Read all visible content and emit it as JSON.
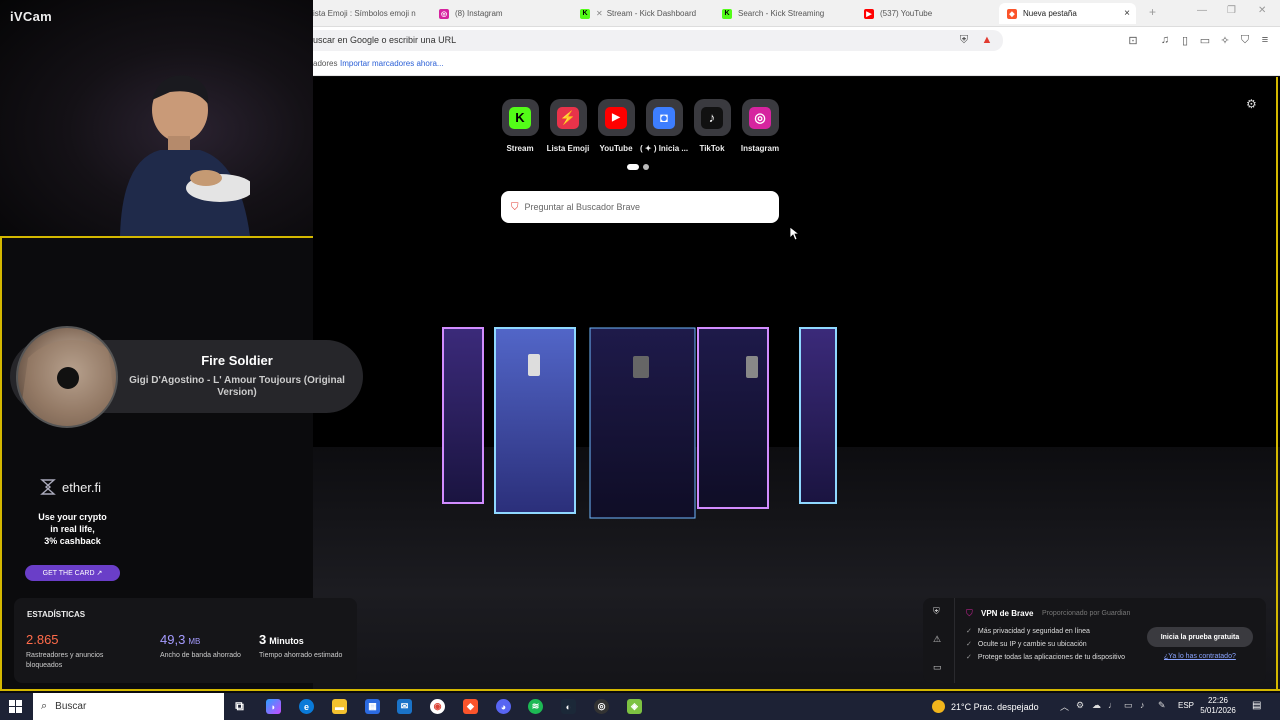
{
  "webcam": {
    "label": "iVCam"
  },
  "browser": {
    "tabs": [
      {
        "title": "ista Emoji : Símbolos emoji n",
        "icon": "",
        "color": "#999999"
      },
      {
        "title": "(8) Instagram",
        "icon": "instagram-icon",
        "color": "#d6249f"
      },
      {
        "title": "Stream - Kick Dashboard",
        "icon": "kick-icon",
        "color": "#53fc18"
      },
      {
        "title": "Search - Kick Streaming",
        "icon": "kick-icon",
        "color": "#53fc18"
      },
      {
        "title": "(537) YouTube",
        "icon": "youtube-icon",
        "color": "#ff0000"
      },
      {
        "title": "Nueva pestaña",
        "icon": "brave-icon",
        "color": "#fb542b"
      }
    ],
    "new_tab_symbol": "+",
    "close_symbol": "×",
    "address": {
      "text": "uscar en Google o escribir una URL"
    },
    "bookmarks": {
      "prefix": "adores",
      "import_link": "Importar marcadores ahora..."
    }
  },
  "newtab": {
    "shortcuts": [
      {
        "label": "Stream",
        "icon": "kick-icon",
        "glyph": "K",
        "bg": "#53fc18",
        "fg": "#000000"
      },
      {
        "label": "Lista Emoji",
        "icon": "emoji-list-icon",
        "glyph": "⚡",
        "bg": "#e8334a",
        "fg": "#ffffff"
      },
      {
        "label": "YouTube",
        "icon": "youtube-icon",
        "glyph": "▶",
        "bg": "#ff0000",
        "fg": "#ffffff"
      },
      {
        "label": "( ✦ ) Inicia ...",
        "icon": "roblox-icon",
        "glyph": "◘",
        "bg": "#3d7eff",
        "fg": "#ffffff"
      },
      {
        "label": "TikTok",
        "icon": "tiktok-icon",
        "glyph": "♪",
        "bg": "#111111",
        "fg": "#ffffff"
      },
      {
        "label": "Instagram",
        "icon": "instagram-icon",
        "glyph": "◎",
        "bg": "#d6249f",
        "fg": "#ffffff"
      }
    ],
    "search_placeholder": "Preguntar al Buscador Brave"
  },
  "now_playing": {
    "title": "Fire Soldier",
    "artist": "Gigi D'Agostino - L' Amour Toujours (Original Version)"
  },
  "sponsor": {
    "brand": "ether.fi",
    "tagline_1": "Use your crypto",
    "tagline_2": "in real life,",
    "tagline_3": "3% cashback",
    "cta": "GET THE CARD ↗"
  },
  "stats": {
    "title": "ESTADÍSTICAS",
    "items": [
      {
        "value": "2.865",
        "unit": "",
        "desc": "Rastreadores y anuncios bloqueados",
        "color": "#ff6b4a"
      },
      {
        "value": "49,3",
        "unit": "MB",
        "desc": "Ancho de banda ahorrado",
        "color": "#a59bff"
      },
      {
        "value": "3",
        "unit": "Minutos",
        "desc": "Tiempo ahorrado estimado",
        "color": "#ffffff"
      }
    ]
  },
  "vpn": {
    "title": "VPN de Brave",
    "provider": "Proporcionado por  Guardian",
    "features": [
      "Más privacidad y seguridad en línea",
      "Oculte su IP y cambie su ubicación",
      "Protege todas las aplicaciones de tu dispositivo"
    ],
    "trial_button": "Inicia la prueba gratuita",
    "already_link": "¿Ya lo has contratado?"
  },
  "taskbar": {
    "search_placeholder": "Buscar",
    "weather": "21°C  Prac. despejado",
    "lang": "ESP",
    "time": "22:26",
    "date": "5/01/2026"
  }
}
